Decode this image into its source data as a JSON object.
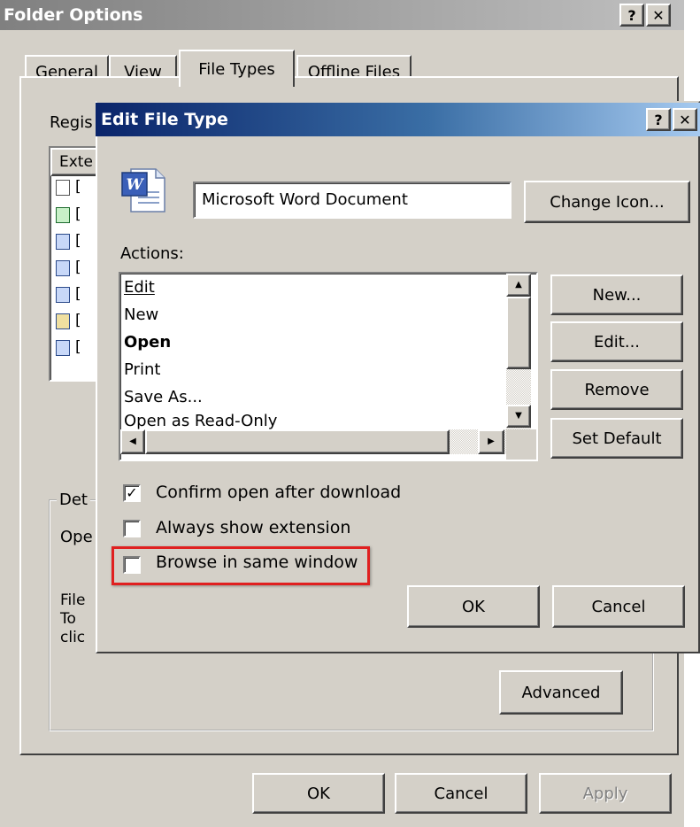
{
  "outer": {
    "title": "Folder Options",
    "help_button": "?",
    "close_button": "✕",
    "tabs": [
      {
        "label": "General"
      },
      {
        "label": "View"
      },
      {
        "label": "File Types"
      },
      {
        "label": "Offline Files"
      }
    ],
    "registered_label": "Regis",
    "column_header": "Exte",
    "row_letters": [
      "[",
      "[",
      "[",
      "[",
      "[",
      "[",
      "["
    ],
    "details_group_label": "Det",
    "opens_label": "Ope",
    "file_text_1": "File",
    "file_text_2": "To",
    "file_text_3": "clic",
    "advanced_button": "Advanced",
    "ok_button": "OK",
    "cancel_button": "Cancel",
    "apply_button": "Apply"
  },
  "dialog": {
    "title": "Edit File Type",
    "help_button": "?",
    "close_button": "✕",
    "file_type_name": "Microsoft Word Document",
    "change_icon_button": "Change Icon...",
    "actions_label": "Actions:",
    "actions": [
      {
        "label": "Edit",
        "bold": false
      },
      {
        "label": "New",
        "bold": false
      },
      {
        "label": "Open",
        "bold": true
      },
      {
        "label": "Print",
        "bold": false
      },
      {
        "label": "Save As...",
        "bold": false
      },
      {
        "label": "Open as Read-Only",
        "bold": false
      }
    ],
    "new_button": "New...",
    "edit_button": "Edit...",
    "remove_button": "Remove",
    "set_default_button": "Set Default",
    "checkboxes": [
      {
        "label": "Confirm open after download",
        "checked": true
      },
      {
        "label": "Always show extension",
        "checked": false
      },
      {
        "label": "Browse in same window",
        "checked": false
      }
    ],
    "ok_button": "OK",
    "cancel_button": "Cancel"
  },
  "colors": {
    "window_bg": "#d4d0c8",
    "active_title_start": "#0a246a",
    "active_title_end": "#a6caf0",
    "inactive_title": "#808080",
    "highlight_box": "#e02020"
  },
  "icons": [
    "word-document-icon",
    "checkmark-icon",
    "arrow-up-icon",
    "arrow-down-icon",
    "arrow-left-icon",
    "arrow-right-icon"
  ]
}
